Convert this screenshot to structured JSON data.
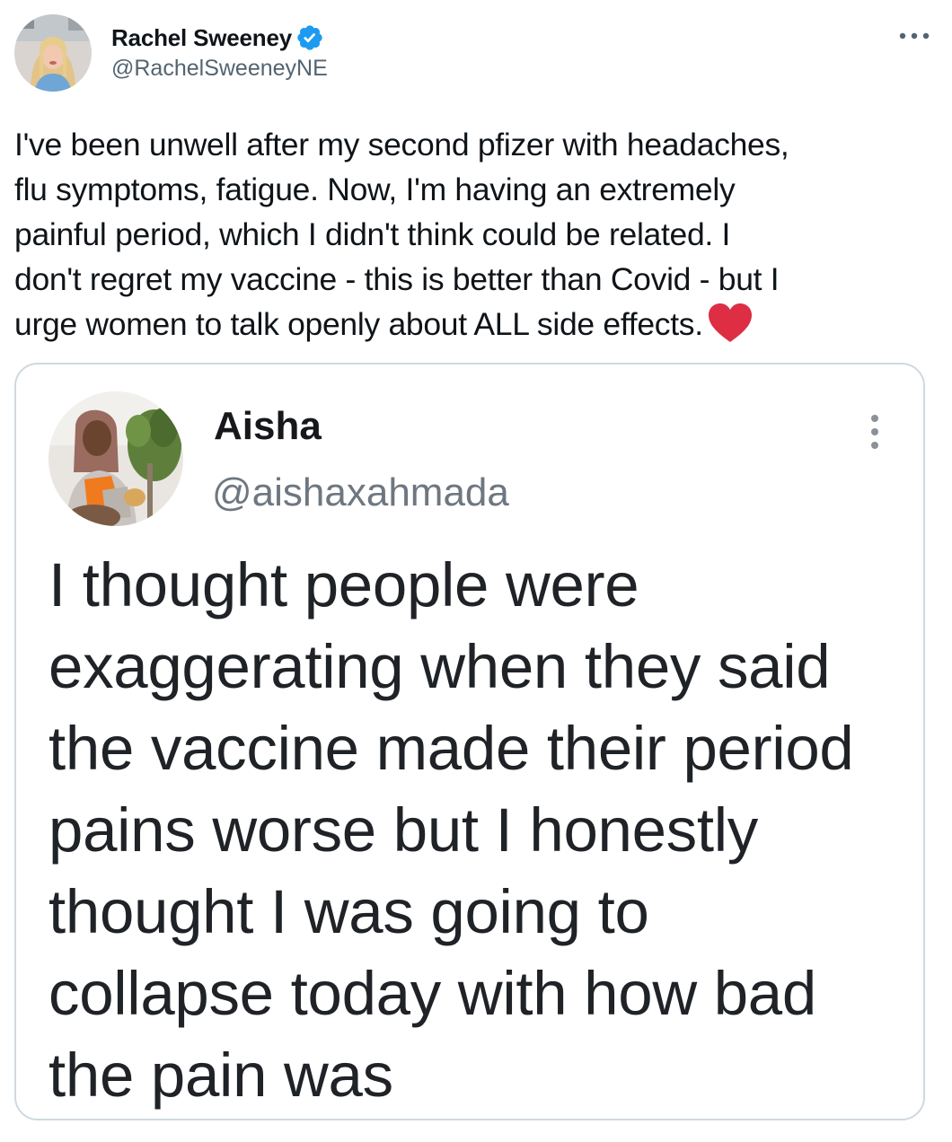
{
  "tweet": {
    "author": {
      "display_name": "Rachel Sweeney",
      "handle": "@RachelSweeneyNE",
      "verified": true,
      "avatar_icon": "profile-photo-avatar"
    },
    "more_icon": "more-horizontal-icon",
    "text_lines": [
      "I've been unwell after my second pfizer with headaches,",
      "flu symptoms, fatigue. Now, I'm having an extremely",
      "painful period, which I didn't think could be related. I",
      "don't regret my vaccine - this is better than Covid - but I",
      "urge women to talk openly about ALL side effects."
    ],
    "emoji": "red-heart"
  },
  "quoted": {
    "author": {
      "display_name": "Aisha",
      "handle": "@aishaxahmada",
      "avatar_icon": "profile-photo-avatar"
    },
    "more_icon": "more-vertical-icon",
    "text_lines": [
      "I thought people were",
      "exaggerating when they said",
      "the vaccine made their period",
      "pains worse but I honestly",
      "thought I was going to",
      "collapse today with how bad",
      "the pain was"
    ]
  },
  "colors": {
    "verified_blue": "#1d9bf0",
    "heart_red": "#dd2e44",
    "secondary_text": "#536471",
    "card_border": "#cfd9de"
  }
}
